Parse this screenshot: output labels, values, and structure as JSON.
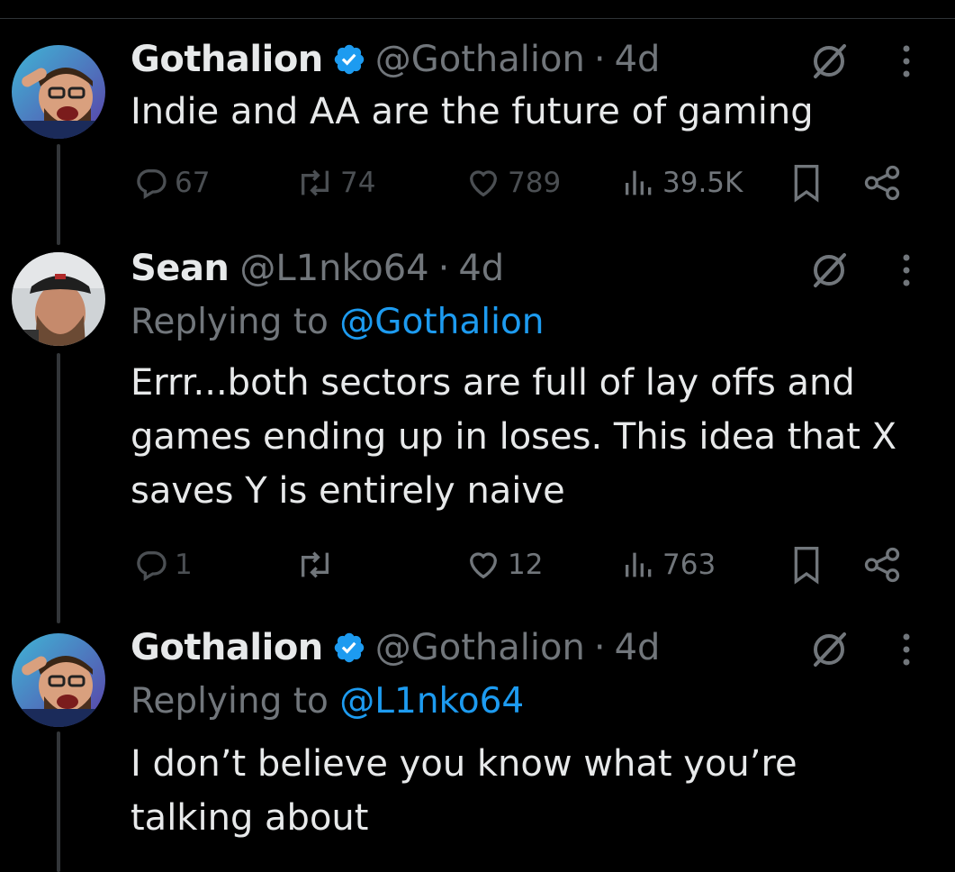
{
  "tweets": [
    {
      "name": "Gothalion",
      "verified": true,
      "handle": "@Gothalion",
      "separator": "·",
      "time": "4d",
      "reply_to": null,
      "text": "Indie and AA are the future of gaming",
      "stats": {
        "replies": "67",
        "reposts": "74",
        "likes": "789",
        "views": "39.5K"
      }
    },
    {
      "name": "Sean",
      "verified": false,
      "handle": "@L1nko64",
      "separator": "·",
      "time": "4d",
      "reply_prefix": "Replying to",
      "reply_to": "@Gothalion",
      "text": "Errr...both sectors are full of lay offs and\ngames ending up in loses. This idea that X\nsaves Y is entirely naive",
      "stats": {
        "replies": "1",
        "reposts": "",
        "likes": "12",
        "views": "763"
      }
    },
    {
      "name": "Gothalion",
      "verified": true,
      "handle": "@Gothalion",
      "separator": "·",
      "time": "4d",
      "reply_prefix": "Replying to",
      "reply_to": "@L1nko64",
      "text": "I don’t believe you know what you’re\ntalking about"
    }
  ],
  "icons": {
    "verified": "verified-badge-icon",
    "grok": "grok-icon",
    "more": "more-icon",
    "reply": "reply-icon",
    "repost": "repost-icon",
    "like": "like-icon",
    "views": "views-icon",
    "bookmark": "bookmark-icon",
    "share": "share-icon"
  },
  "colors": {
    "background": "#000000",
    "text": "#e7e9ea",
    "muted": "#71767b",
    "link": "#1d9bf0",
    "line": "#333639"
  }
}
